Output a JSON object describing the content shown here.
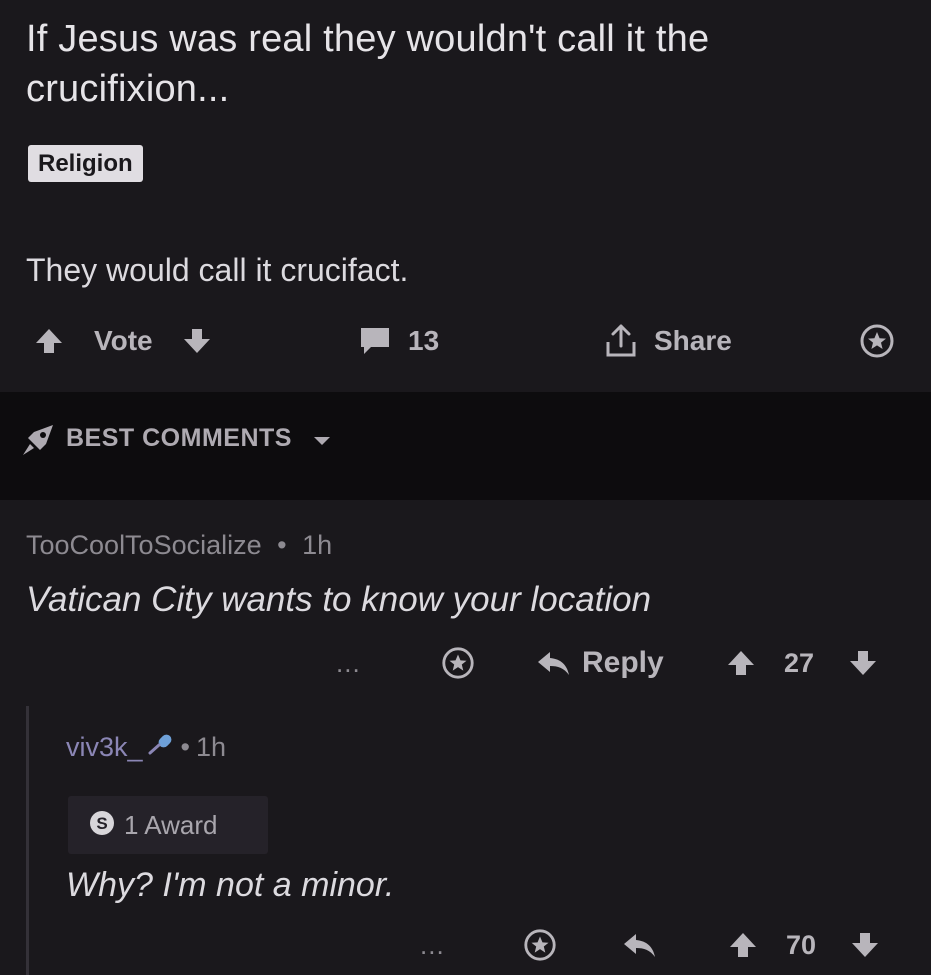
{
  "post": {
    "title": "If Jesus was real they wouldn't call it the crucifixion...",
    "flair": "Religion",
    "body": "They would call it crucifact.",
    "actions": {
      "vote_label": "Vote",
      "comment_count": "13",
      "share_label": "Share"
    }
  },
  "sort": {
    "label": "BEST COMMENTS"
  },
  "comments": [
    {
      "username": "TooCoolToSocialize",
      "separator": "•",
      "time": "1h",
      "body": "Vatican City wants to know your location",
      "more": "...",
      "reply_label": "Reply",
      "score": "27"
    },
    {
      "username": "viv3k_",
      "separator": "•",
      "time": "1h",
      "award": "1 Award",
      "award_badge": "S",
      "body": "Why? I'm not a minor.",
      "more": "...",
      "score": "70"
    }
  ],
  "icons": [
    "upvote-icon",
    "downvote-icon",
    "comment-icon",
    "share-icon",
    "award-icon",
    "rocket-icon",
    "caret-down-icon",
    "reply-icon",
    "microphone-icon",
    "silver-award-icon"
  ],
  "colors": {
    "background": "#1a181c",
    "band": "#0d0c0e",
    "text": "#dcdadf",
    "muted": "#8d8a91",
    "username_accent": "#8b86b5"
  }
}
